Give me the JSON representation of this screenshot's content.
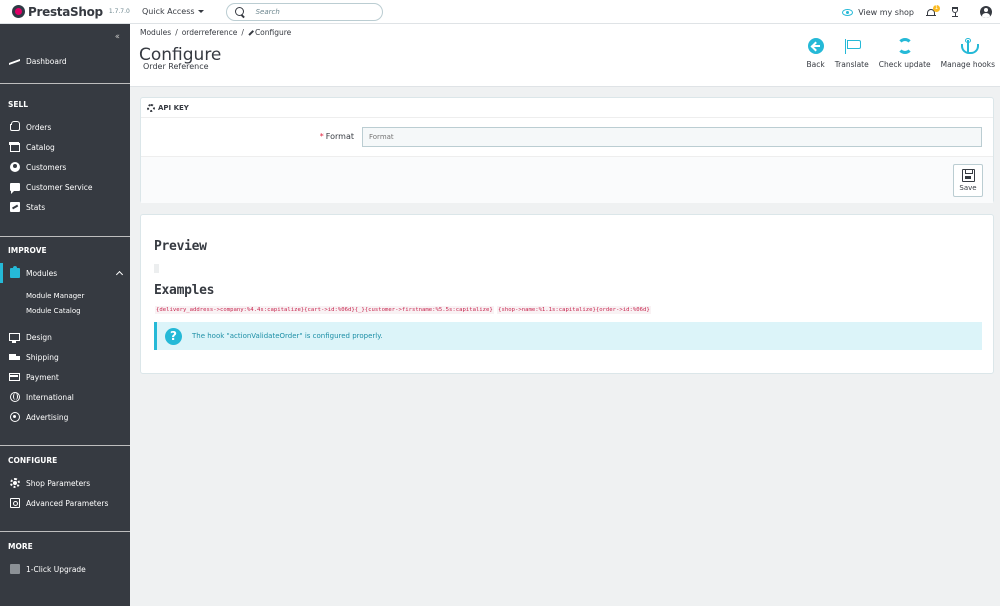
{
  "header": {
    "brand": "PrestaShop",
    "version": "1.7.7.0",
    "quick_access": "Quick Access",
    "search_placeholder": "Search",
    "view_shop": "View my shop",
    "notification_count": "1"
  },
  "sidebar": {
    "collapse_label": "‹‹",
    "dashboard": "Dashboard",
    "sections": {
      "sell": "SELL",
      "improve": "IMPROVE",
      "configure": "CONFIGURE",
      "more": "MORE"
    },
    "sell_items": [
      "Orders",
      "Catalog",
      "Customers",
      "Customer Service",
      "Stats"
    ],
    "improve_items": {
      "modules": "Modules",
      "module_manager": "Module Manager",
      "module_catalog": "Module Catalog",
      "design": "Design",
      "shipping": "Shipping",
      "payment": "Payment",
      "international": "International",
      "advertising": "Advertising"
    },
    "configure_items": [
      "Shop Parameters",
      "Advanced Parameters"
    ],
    "more_items": [
      "1-Click Upgrade"
    ]
  },
  "page": {
    "breadcrumb": [
      "Modules",
      "orderreference",
      "Configure"
    ],
    "title": "Configure",
    "subtitle": "Order Reference",
    "toolbar": {
      "back": "Back",
      "translate": "Translate",
      "check_update": "Check update",
      "manage_hooks": "Manage hooks"
    }
  },
  "api_panel": {
    "heading": "API KEY",
    "format_label": "Format",
    "format_required_mark": "*",
    "format_placeholder": "Format",
    "format_value": "",
    "save_label": "Save"
  },
  "preview_panel": {
    "preview_heading": "Preview",
    "examples_heading": "Examples",
    "example_code_1": "{delivery_address->company:%4.4s:capitalize}{cart->id:%06d}{_}{customer->firstname:%5.5s:capitalize}",
    "example_code_2": "{shop->name:%1.1s:capitalize}{order->id:%06d}",
    "info_message": "The hook \"actionValidateOrder\" is configured properly."
  },
  "colors": {
    "accent": "#25b9d7",
    "sidebar_bg": "#363a41",
    "page_bg": "#eff1f2",
    "code_text": "#c7254e",
    "required": "#e4243f",
    "badge": "#fbbb22"
  }
}
